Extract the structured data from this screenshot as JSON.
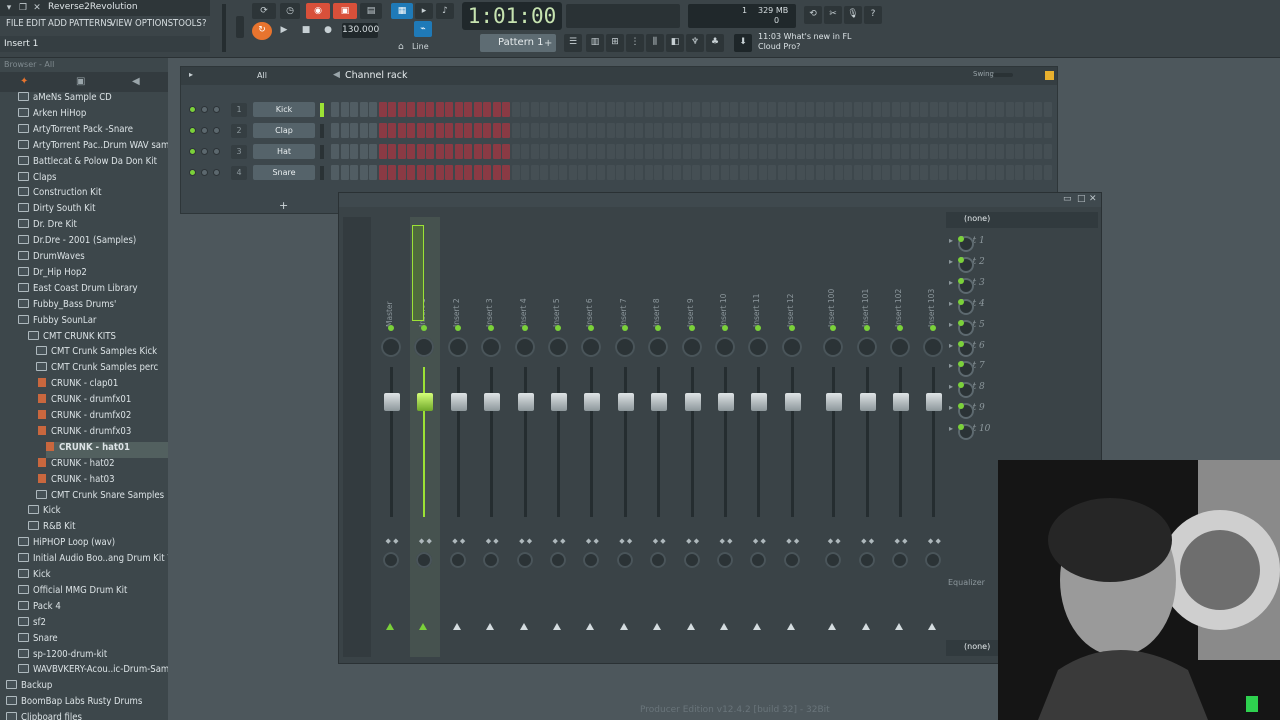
{
  "titlebar": {
    "project": "Reverse2Revolution"
  },
  "menu": [
    "FILE",
    "EDIT",
    "ADD",
    "PATTERNS",
    "VIEW",
    "OPTIONS",
    "TOOLS",
    "?"
  ],
  "hint": "Insert 1",
  "transport": {
    "time": "1:01:00",
    "tempo": "130.000",
    "snap": "Line",
    "pattern": "Pattern 1"
  },
  "cpu": {
    "cpu_value": "1",
    "memory": "329 MB",
    "polyphony": "0"
  },
  "news": {
    "time": "11:03",
    "text1": "What's new in FL",
    "text2": "Cloud Pro?"
  },
  "browser": {
    "header": "Browser - All",
    "items": [
      {
        "label": "aMeNs Sample CD",
        "type": "folder",
        "indent": 0
      },
      {
        "label": "Arken HiHop",
        "type": "folder",
        "indent": 0
      },
      {
        "label": "ArtyTorrent Pack -Snare",
        "type": "folder",
        "indent": 0
      },
      {
        "label": "ArtyTorrent Pac..Drum WAV samples",
        "type": "folder",
        "indent": 0
      },
      {
        "label": "Battlecat & Polow Da Don Kit",
        "type": "folder",
        "indent": 0
      },
      {
        "label": "Claps",
        "type": "folder",
        "indent": 0
      },
      {
        "label": "Construction Kit",
        "type": "folder",
        "indent": 0
      },
      {
        "label": "Dirty South Kit",
        "type": "folder",
        "indent": 0
      },
      {
        "label": "Dr. Dre Kit",
        "type": "folder",
        "indent": 0
      },
      {
        "label": "Dr.Dre - 2001 (Samples)",
        "type": "folder",
        "indent": 0
      },
      {
        "label": "DrumWaves",
        "type": "folder",
        "indent": 0
      },
      {
        "label": "Dr_Hip Hop2",
        "type": "folder",
        "indent": 0
      },
      {
        "label": "East Coast Drum Library",
        "type": "folder",
        "indent": 0
      },
      {
        "label": "Fubby_Bass Drums'",
        "type": "folder",
        "indent": 0
      },
      {
        "label": "Fubby SounLar",
        "type": "folder",
        "indent": 0
      },
      {
        "label": "CMT CRUNK KITS",
        "type": "folder",
        "indent": 1
      },
      {
        "label": "CMT Crunk Samples Kick",
        "type": "folder",
        "indent": 2
      },
      {
        "label": "CMT Crunk Samples perc",
        "type": "folder",
        "indent": 2
      },
      {
        "label": "CRUNK - clap01",
        "type": "file",
        "indent": 3
      },
      {
        "label": "CRUNK - drumfx01",
        "type": "file",
        "indent": 3
      },
      {
        "label": "CRUNK - drumfx02",
        "type": "file",
        "indent": 3
      },
      {
        "label": "CRUNK - drumfx03",
        "type": "file",
        "indent": 3
      },
      {
        "label": "CRUNK - hat01",
        "type": "file",
        "indent": 4
      },
      {
        "label": "CRUNK - hat02",
        "type": "file",
        "indent": 3
      },
      {
        "label": "CRUNK - hat03",
        "type": "file",
        "indent": 3
      },
      {
        "label": "CMT Crunk Snare Samples",
        "type": "folder",
        "indent": 2
      },
      {
        "label": "Kick",
        "type": "folder",
        "indent": 1
      },
      {
        "label": "R&B Kit",
        "type": "folder",
        "indent": 1
      },
      {
        "label": "HiPHOP Loop (wav)",
        "type": "folder",
        "indent": 0
      },
      {
        "label": "Initial Audio Boo..ang Drum Kit WiN",
        "type": "folder",
        "indent": 0
      },
      {
        "label": "Kick",
        "type": "folder",
        "indent": 0
      },
      {
        "label": "Official MMG Drum Kit",
        "type": "folder",
        "indent": 0
      },
      {
        "label": "Pack 4",
        "type": "folder",
        "indent": 0
      },
      {
        "label": "sf2",
        "type": "folder",
        "indent": 0
      },
      {
        "label": "Snare",
        "type": "folder",
        "indent": 0
      },
      {
        "label": "sp-1200-drum-kit",
        "type": "folder",
        "indent": 0
      },
      {
        "label": "WAVBVKERY-Acou..ic-Drum-Samples",
        "type": "folder",
        "indent": 0
      },
      {
        "label": "Backup",
        "type": "folder",
        "indent": -1
      },
      {
        "label": "BoomBap Labs Rusty Drums",
        "type": "folder",
        "indent": -1
      },
      {
        "label": "Clipboard files",
        "type": "folder",
        "indent": -1
      }
    ]
  },
  "channel_rack": {
    "filter": "All",
    "title": "Channel rack",
    "swing_label": "Swing",
    "add_symbol": "+",
    "channels": [
      {
        "num": "1",
        "name": "Kick"
      },
      {
        "num": "2",
        "name": "Clap"
      },
      {
        "num": "3",
        "name": "Hat"
      },
      {
        "num": "4",
        "name": "Snare"
      }
    ]
  },
  "mixer": {
    "tracks": [
      "Master",
      "Insert 1",
      "Insert 2",
      "Insert 3",
      "Insert 4",
      "Insert 5",
      "Insert 6",
      "Insert 7",
      "Insert 8",
      "Insert 9",
      "Insert 10",
      "Insert 11",
      "Insert 12",
      "Insert 100",
      "Insert 101",
      "Insert 102",
      "Insert 103"
    ],
    "selected_track": "Insert 1",
    "input": "(none)",
    "output": "(none)",
    "eq_label": "Equalizer",
    "slots": [
      "Slot 1",
      "Slot 2",
      "Slot 3",
      "Slot 4",
      "Slot 5",
      "Slot 6",
      "Slot 7",
      "Slot 8",
      "Slot 9",
      "Slot 10"
    ]
  },
  "footer": "Producer Edition v12.4.2 [build 32] - 32Bit",
  "colors": {
    "accent_green": "#9ce235",
    "step_red": "#8a3a44",
    "step_dark": "#4a565c",
    "orange": "#e8742e"
  }
}
